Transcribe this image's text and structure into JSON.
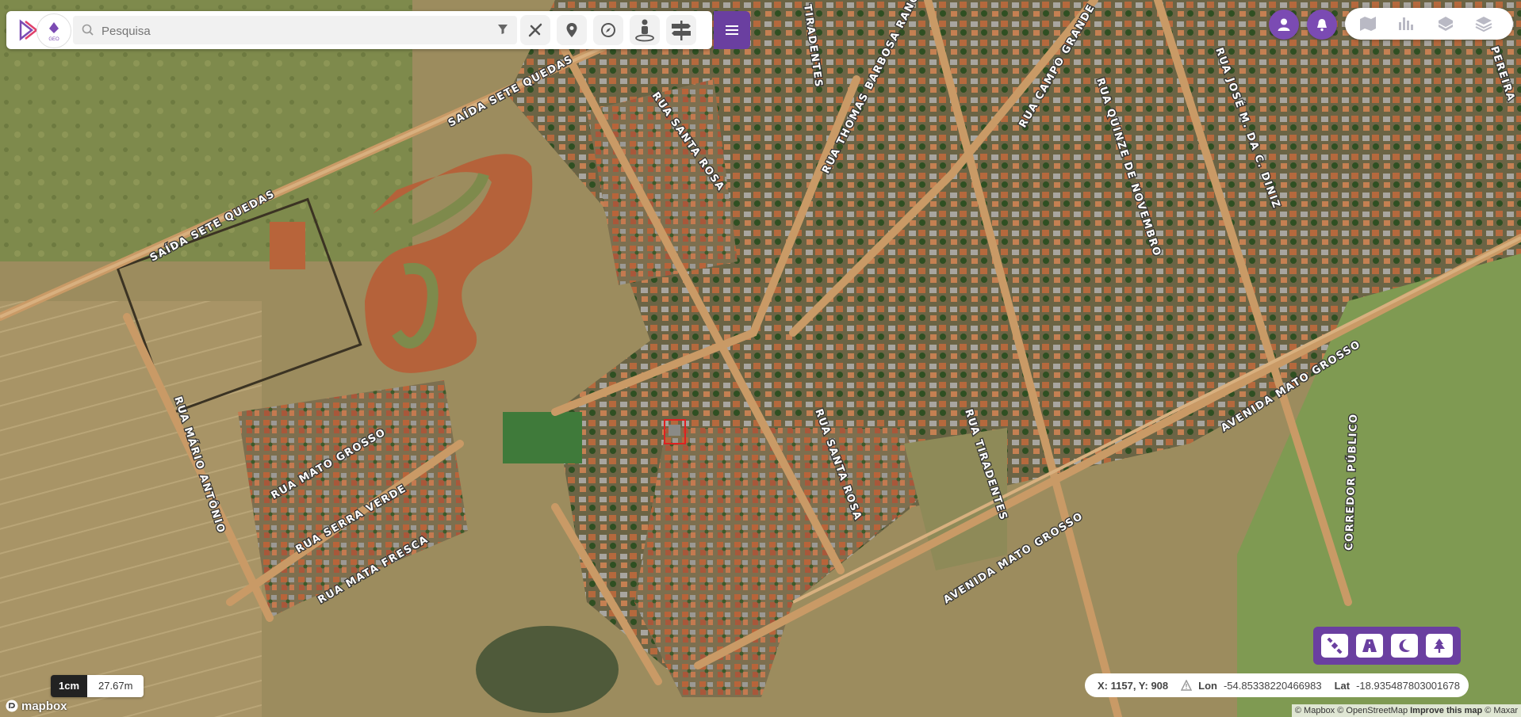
{
  "search": {
    "placeholder": "Pesquisa"
  },
  "toolbar": {
    "tools": [
      {
        "name": "measure-tool-button",
        "icon": "ruler-pencil-icon"
      },
      {
        "name": "marker-tool-button",
        "icon": "map-pin-icon"
      },
      {
        "name": "compass-tool-button",
        "icon": "compass-icon"
      },
      {
        "name": "streetview-tool-button",
        "icon": "person-pin-icon"
      },
      {
        "name": "signpost-tool-button",
        "icon": "signpost-icon"
      }
    ],
    "menu_icon": "hamburger-menu-icon"
  },
  "layer_buttons": [
    "map-icon",
    "bar-chart-icon",
    "stack-icon",
    "layers-icon"
  ],
  "map": {
    "streets": [
      "SAÍDA SETE QUEDAS",
      "SAÍDA SETE QUEDAS",
      "RUA SANTA ROSA",
      "RUA SANTA ROSA",
      "TIRADENTES",
      "RUA THOMAS BARBOSA RANGEL",
      "RUA CAMPO GRANDE",
      "RUA QUINZE DE NOVEMBRO",
      "RUA JOSÉ M. DA C. DINIZ",
      "RUA MÁRIO ANTÔNIO",
      "RUA MATO GROSSO",
      "RUA SERRA VERDE",
      "RUA MATA FRESCA",
      "RUA TIRADENTES",
      "AVENIDA MATO GROSSO",
      "AVENIDA MATO GROSSO",
      "CORREDOR PÚBLICO",
      "PEREIRA"
    ]
  },
  "bottom_tools": [
    "satellite-icon",
    "road-icon",
    "moon-icon",
    "tree-icon"
  ],
  "coords": {
    "xy": "X: 1157, Y: 908",
    "lon_label": "Lon",
    "lon_value": "-54.85338220466983",
    "lat_label": "Lat",
    "lat_value": "-18.935487803001678"
  },
  "scale": {
    "unit": "1cm",
    "value": "27.67m"
  },
  "attribution": {
    "text": "© Mapbox © OpenStreetMap",
    "improve": "Improve this map",
    "maxar": "© Maxar"
  },
  "brand": {
    "mapbox": "mapbox",
    "logo_text": "GEO"
  },
  "colors": {
    "accent": "#6a3fa0",
    "accent_light": "#7b4bb3",
    "highlight": "#e02020"
  }
}
